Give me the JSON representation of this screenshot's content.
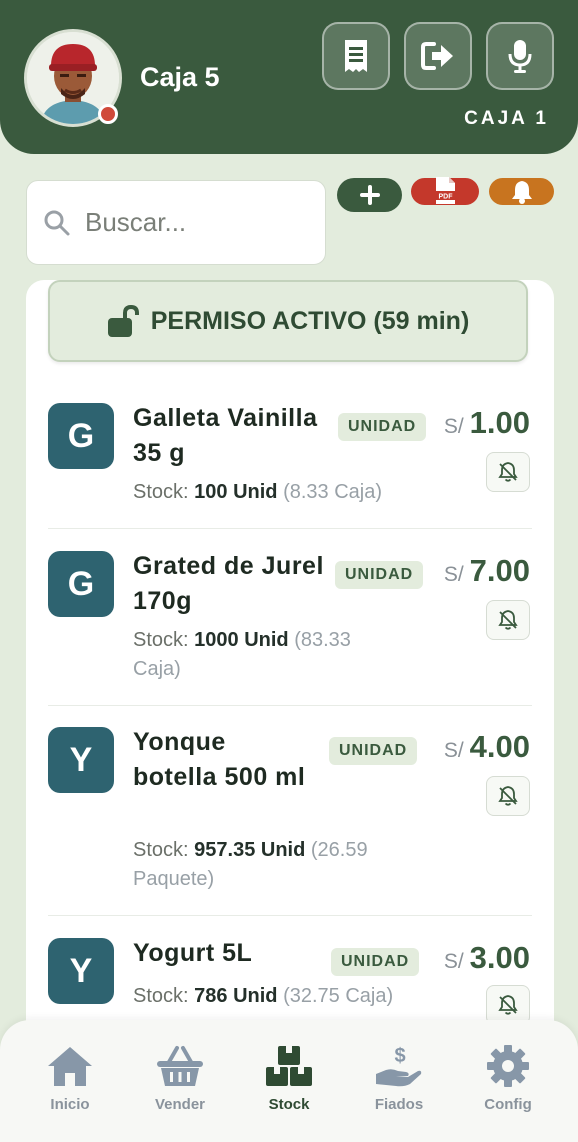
{
  "header": {
    "user_name": "Caja 5",
    "caja_label": "CAJA 1",
    "status_color": "#d04a3a",
    "actions": [
      "receipt-icon",
      "logout-icon",
      "microphone-icon"
    ]
  },
  "search": {
    "placeholder": "Buscar..."
  },
  "actions": [
    {
      "icon": "plus-icon",
      "color": "#3a5a3e"
    },
    {
      "icon": "pdf-icon",
      "color": "#c4382b",
      "text": "PDF"
    },
    {
      "icon": "bell-icon",
      "color": "#c8741f"
    }
  ],
  "permiso": {
    "label": "PERMISO ACTIVO (59 min)",
    "icon": "unlock-icon"
  },
  "products": [
    {
      "letter": "G",
      "name": "Galleta Vainilla 35 g",
      "badge": "UNIDAD",
      "currency": "S/",
      "price": "1.00",
      "stock_label": "Stock:",
      "stock_value": "100 Unid",
      "stock_sub": "(8.33 Caja)"
    },
    {
      "letter": "G",
      "name": "Grated de Jurel 170g",
      "badge": "UNIDAD",
      "currency": "S/",
      "price": "7.00",
      "stock_label": "Stock:",
      "stock_value": "1000 Unid",
      "stock_sub": "(83.33 Caja)"
    },
    {
      "letter": "Y",
      "name": "Yonque botella 500 ml",
      "badge": "UNIDAD",
      "currency": "S/",
      "price": "4.00",
      "stock_label": "Stock:",
      "stock_value": "957.35 Unid",
      "stock_sub": "(26.59 Paquete)"
    },
    {
      "letter": "Y",
      "name": "Yogurt 5L",
      "badge": "UNIDAD",
      "currency": "S/",
      "price": "3.00",
      "stock_label": "Stock:",
      "stock_value": "786 Unid",
      "stock_sub": "(32.75 Caja)"
    }
  ],
  "nav": [
    {
      "label": "Inicio",
      "icon": "home-icon",
      "active": false
    },
    {
      "label": "Vender",
      "icon": "basket-icon",
      "active": false
    },
    {
      "label": "Stock",
      "icon": "boxes-icon",
      "active": true
    },
    {
      "label": "Fiados",
      "icon": "hand-dollar-icon",
      "active": false
    },
    {
      "label": "Config",
      "icon": "gear-icon",
      "active": false
    }
  ],
  "colors": {
    "primary": "#3a5a3e",
    "tile": "#2e6370",
    "background": "#e3ecdd"
  }
}
